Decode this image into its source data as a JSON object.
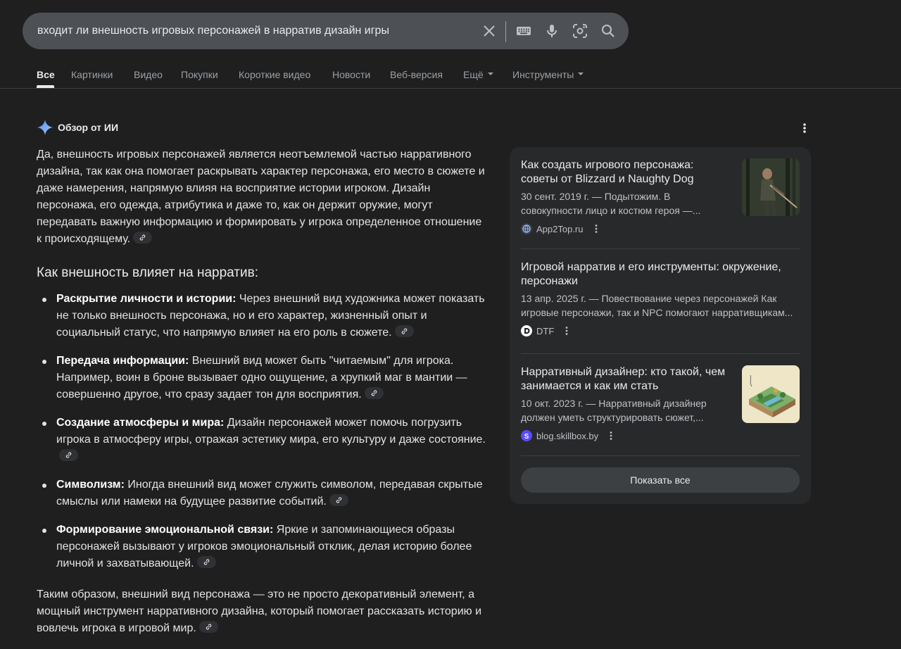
{
  "search": {
    "query": "входит ли внешность игровых персонажей в нарратив дизайн игры"
  },
  "tabs": [
    {
      "label": "Все"
    },
    {
      "label": "Картинки"
    },
    {
      "label": "Видео"
    },
    {
      "label": "Покупки"
    },
    {
      "label": "Короткие видео"
    },
    {
      "label": "Новости"
    },
    {
      "label": "Веб-версия"
    },
    {
      "label": "Ещё"
    },
    {
      "label": "Инструменты"
    }
  ],
  "ai_overview": {
    "title": "Обзор от ИИ",
    "intro": "Да, внешность игровых персонажей является неотъемлемой частью нарративного дизайна, так как она помогает раскрывать характер персонажа, его место в сюжете и даже намерения, напрямую влияя на восприятие истории игроком. Дизайн персонажа, его одежда, атрибутика и даже то, как он держит оружие, могут передавать важную информацию и формировать у игрока определенное отношение к происходящему.",
    "heading": "Как внешность влияет на нарратив:",
    "bullets": [
      {
        "bold": "Раскрытие личности и истории:",
        "text": " Через внешний вид художника может показать не только внешность персонажа, но и его характер, жизненный опыт и социальный статус, что напрямую влияет на его роль в сюжете."
      },
      {
        "bold": "Передача информации:",
        "text": " Внешний вид может быть \"читаемым\" для игрока. Например, воин в броне вызывает одно ощущение, а хрупкий маг в мантии — совершенно другое, что сразу задает тон для восприятия."
      },
      {
        "bold": "Создание атмосферы и мира:",
        "text": " Дизайн персонажей может помочь погрузить игрока в атмосферу игры, отражая эстетику мира, его культуру и даже состояние."
      },
      {
        "bold": "Символизм:",
        "text": " Иногда внешний вид может служить символом, передавая скрытые смыслы или намеки на будущее развитие событий."
      },
      {
        "bold": "Формирование эмоциональной связи:",
        "text": " Яркие и запоминающиеся образы персонажей вызывают у игроков эмоциональный отклик, делая историю более личной и захватывающей."
      }
    ],
    "conclusion": "Таким образом, внешний вид персонажа — это не просто декоративный элемент, а мощный инструмент нарративного дизайна, который помогает рассказать историю и вовлечь игрока в игровой мир."
  },
  "sources": [
    {
      "title": "Как создать игрового персонажа: советы от Blizzard и Naughty Dog",
      "snippet": "30 сент. 2019 г. — Подытожим. В совокупности лицо и костюм героя —...",
      "site": "App2Top.ru",
      "favicon_color": "#8ab4f8"
    },
    {
      "title": "Игровой нарратив и его инструменты: окружение, персонажи",
      "snippet": "13 апр. 2025 г. — Повествование через персонажей Как игровые персонажи, так и NPC помогают нарративщикам...",
      "site": "DTF",
      "favicon_color": "#ffffff"
    },
    {
      "title": "Нарративный дизайнер: кто такой, чем занимается и как им стать",
      "snippet": "10 окт. 2023 г. — Нарративный дизайнер должен уметь структурировать сюжет,...",
      "site": "blog.skillbox.by",
      "favicon_color": "#5b4cff"
    }
  ],
  "show_all_label": "Показать все"
}
